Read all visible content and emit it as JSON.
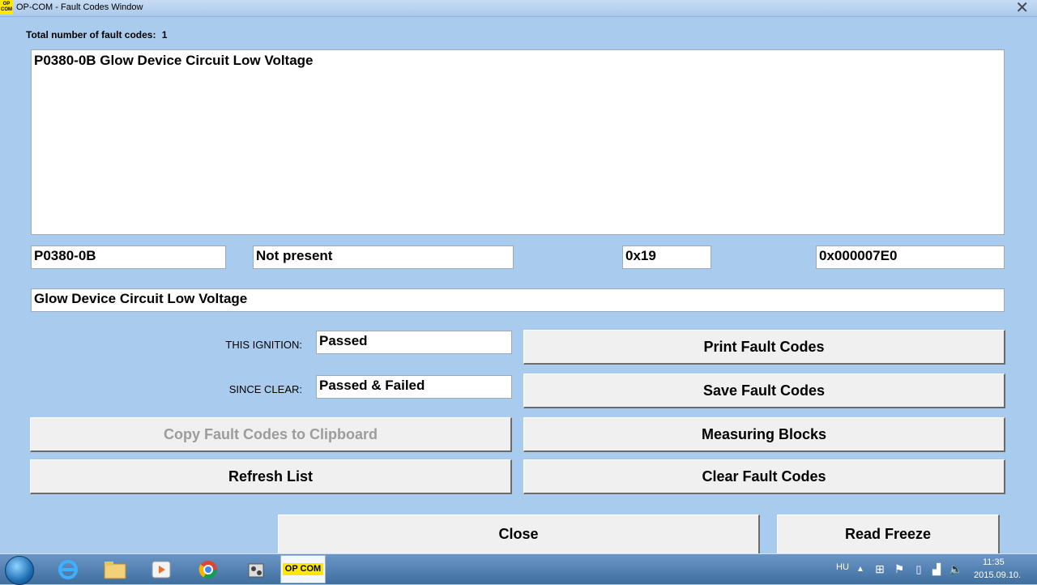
{
  "window": {
    "app_icon_text": "OP COM",
    "title": "OP-COM - Fault Codes Window",
    "close_glyph": "✕"
  },
  "summary": {
    "label": "Total number of fault codes:",
    "count": "1"
  },
  "fault_list": {
    "items": [
      "P0380-0B Glow Device Circuit Low Voltage"
    ]
  },
  "details": {
    "code": "P0380-0B",
    "status": "Not present",
    "hex_code": "0x19",
    "address": "0x000007E0",
    "description": "Glow Device Circuit Low Voltage"
  },
  "state": {
    "this_ignition_label": "THIS IGNITION:",
    "this_ignition_value": "Passed",
    "since_clear_label": "SINCE CLEAR:",
    "since_clear_value": "Passed & Failed"
  },
  "buttons": {
    "print": "Print Fault Codes",
    "save": "Save Fault Codes",
    "copy": "Copy Fault Codes to Clipboard",
    "measuring": "Measuring Blocks",
    "refresh": "Refresh List",
    "clear": "Clear Fault Codes",
    "close": "Close",
    "freeze": "Read Freeze"
  },
  "taskbar": {
    "opcom_label": "OP COM",
    "language": "HU",
    "time": "11:35",
    "date": "2015.09.10."
  }
}
